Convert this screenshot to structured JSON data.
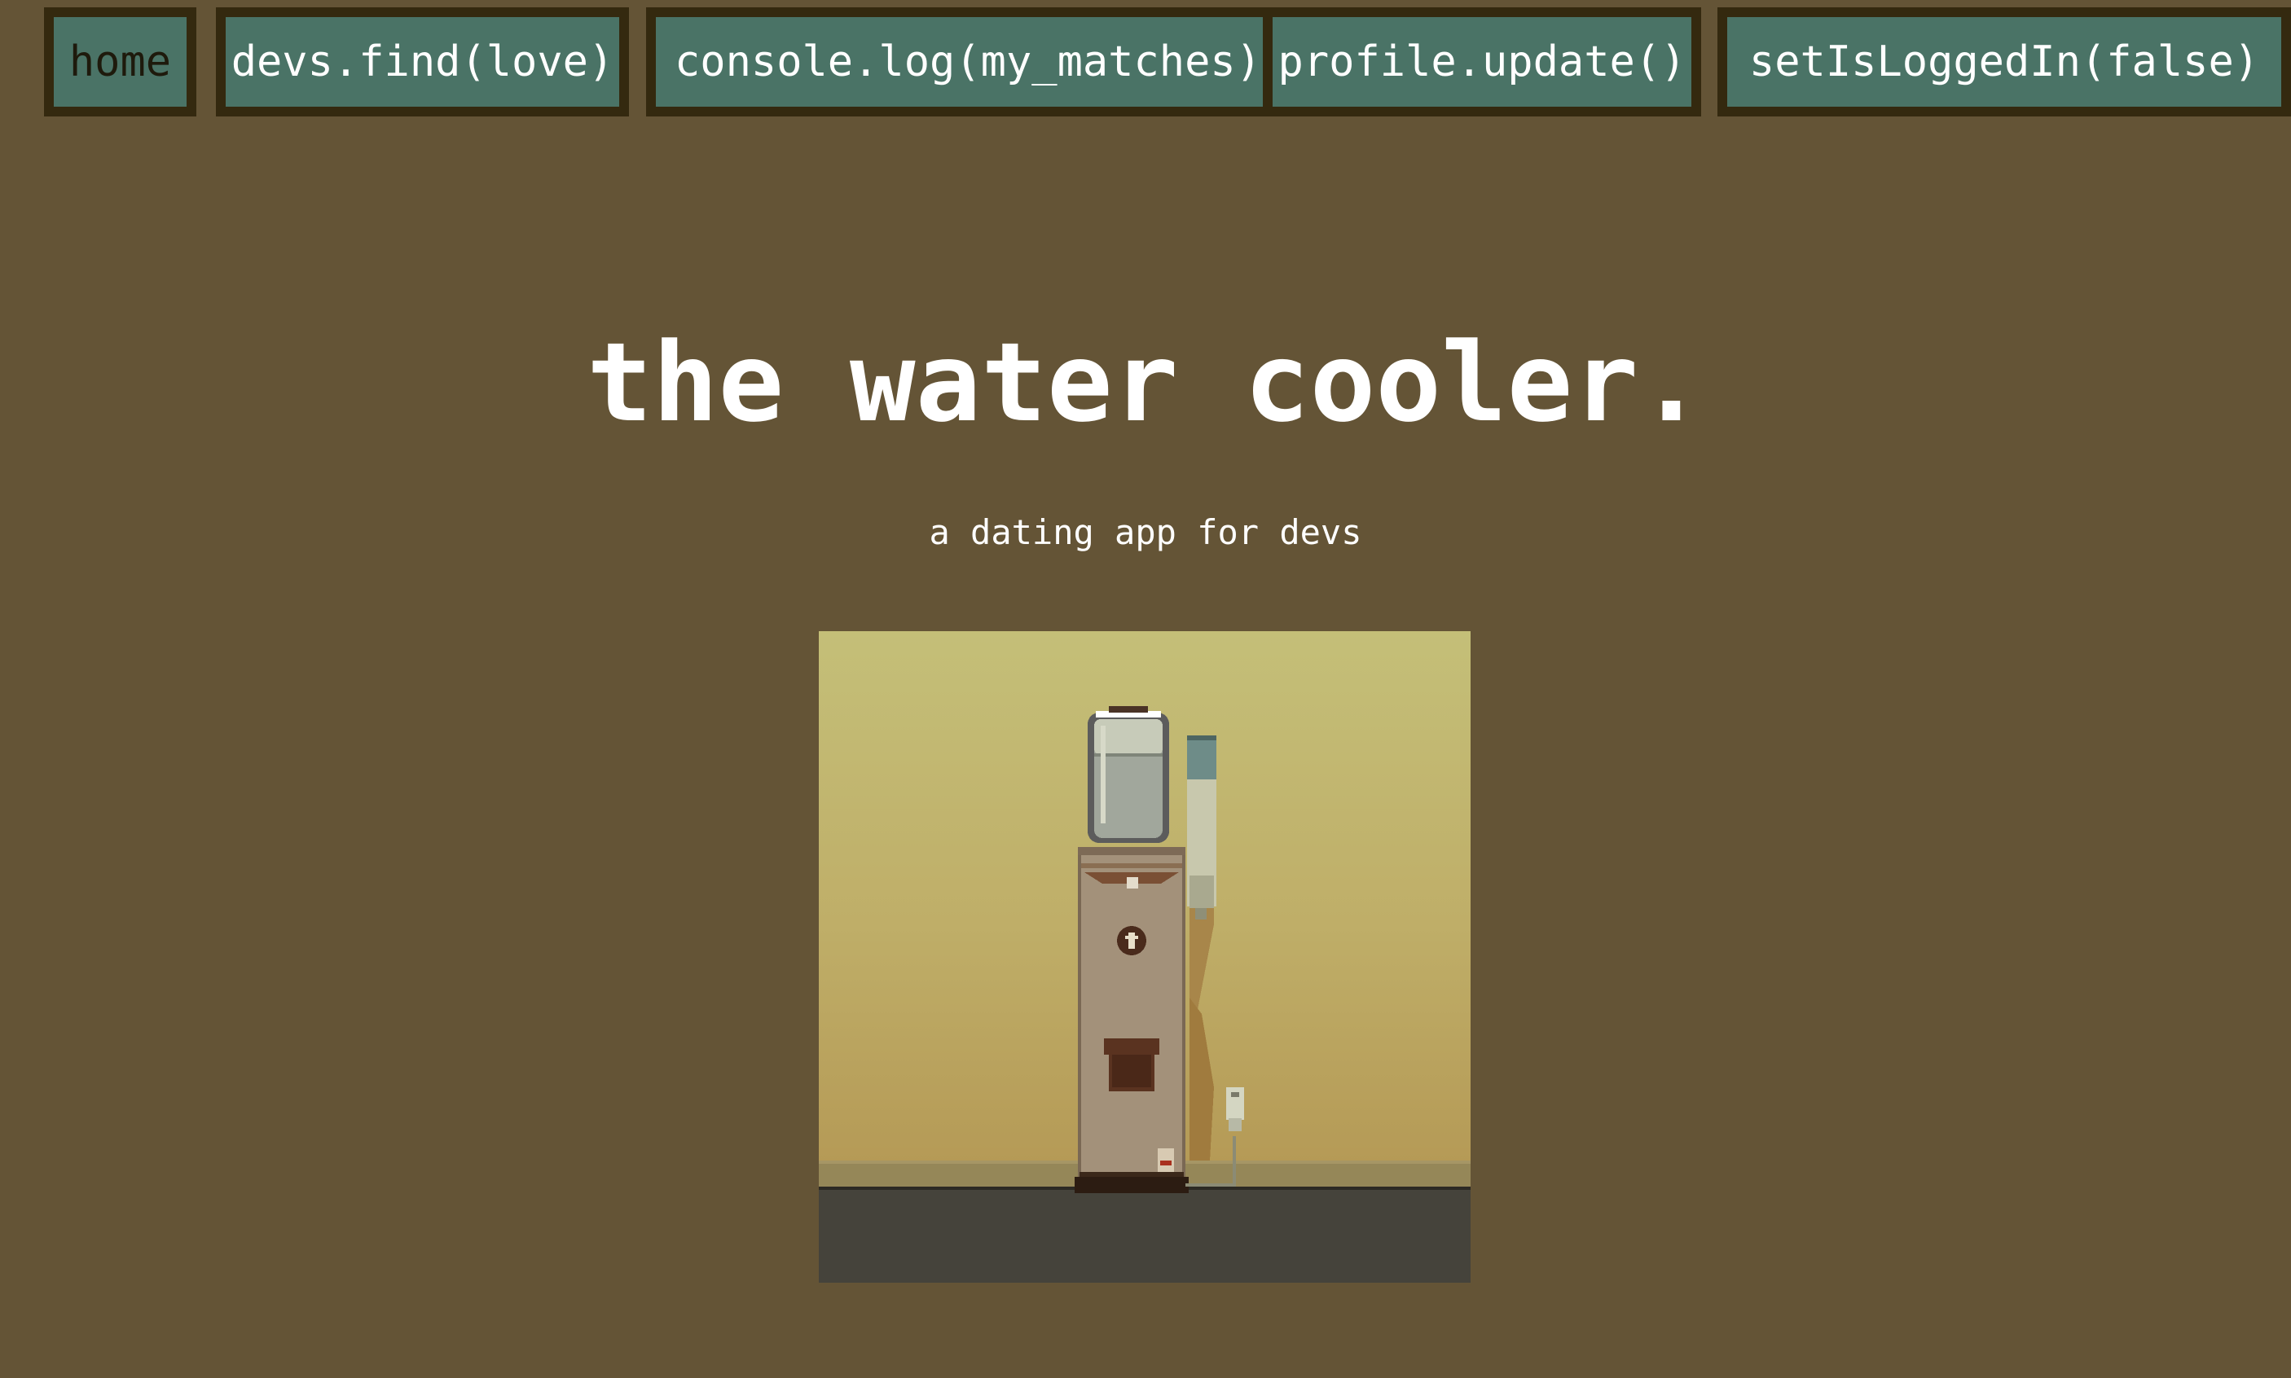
{
  "nav": {
    "items": [
      {
        "label": "home",
        "active": true
      },
      {
        "label": "devs.find(love)",
        "active": false
      },
      {
        "label": "console.log(my_matches)",
        "active": false
      },
      {
        "label": "profile.update()",
        "active": false
      },
      {
        "label": "setIsLoggedIn(false)",
        "active": false
      }
    ]
  },
  "hero": {
    "title": "the water cooler.",
    "subtitle": "a dating app for devs",
    "image_icon": "water-cooler-pixel-art"
  },
  "colors": {
    "page_background": "#645436",
    "button_background": "#4a7366",
    "button_border": "#34290f",
    "text": "#ffffff"
  }
}
